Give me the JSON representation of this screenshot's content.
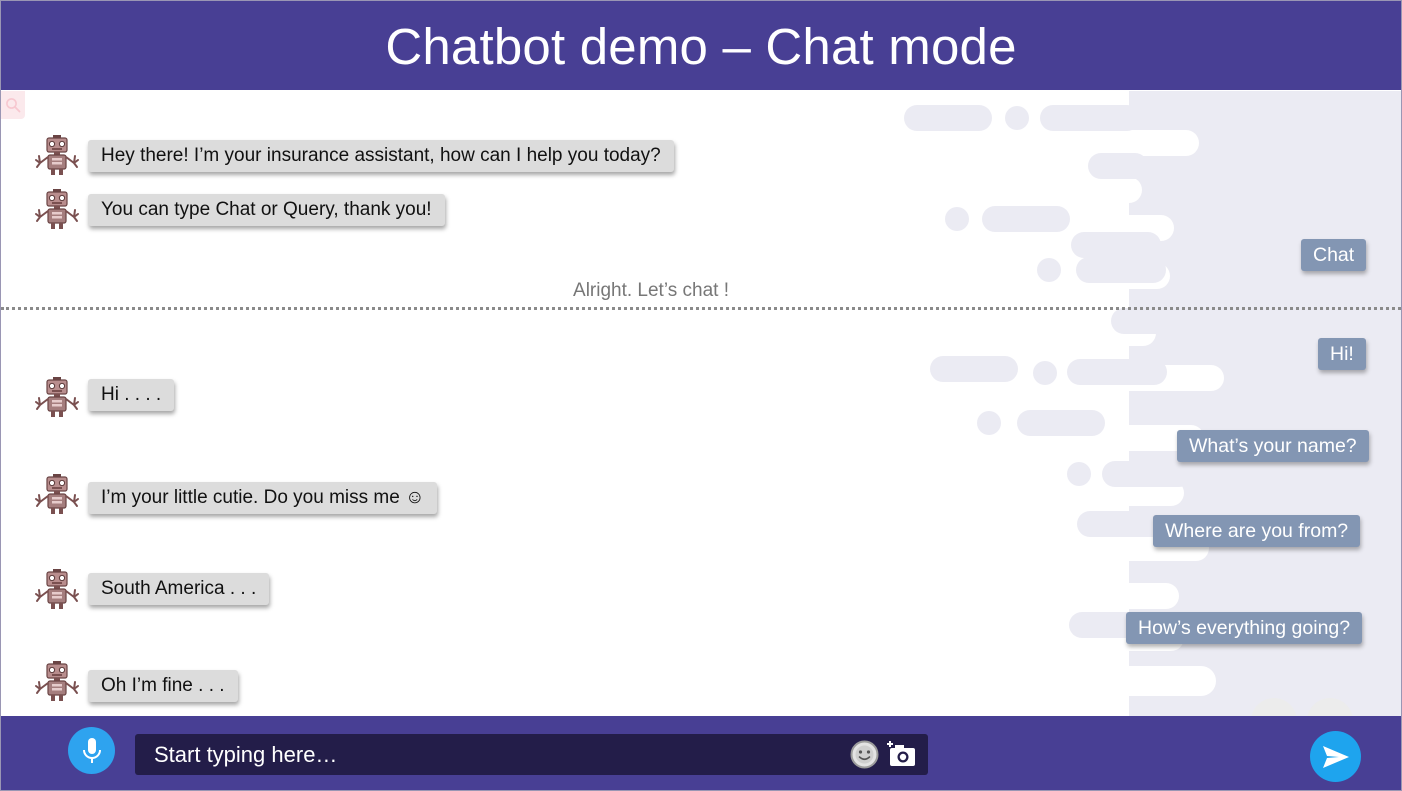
{
  "header": {
    "title": "Chatbot demo – Chat mode"
  },
  "intro_messages": [
    {
      "text": "Hey there! I’m your insurance assistant, how can I help you today?"
    },
    {
      "text": "You can type Chat or Query, thank you!"
    }
  ],
  "mode_choice": {
    "text": "Chat"
  },
  "divider": {
    "text": "Alright. Let’s chat !"
  },
  "conversation": {
    "user": [
      "Hi!",
      "What’s your name?",
      "Where are you from?",
      "How’s everything going?"
    ],
    "bot": [
      "Hi . . . .",
      "I’m your little cutie. Do you miss me ☺",
      "South America . . .",
      "Oh I’m fine . . ."
    ]
  },
  "input": {
    "placeholder": "Start typing here…"
  },
  "icons": {
    "search": "search-icon",
    "avatar": "robot-avatar-icon",
    "mic": "microphone-icon",
    "emoji": "smiley-icon",
    "camera": "camera-icon",
    "send": "send-icon"
  },
  "colors": {
    "header_bg": "#483f94",
    "bot_bubble": "#dcdcdc",
    "user_bubble": "#8396b3",
    "accent": "#1ea4ee",
    "input_bg": "#231d49"
  }
}
